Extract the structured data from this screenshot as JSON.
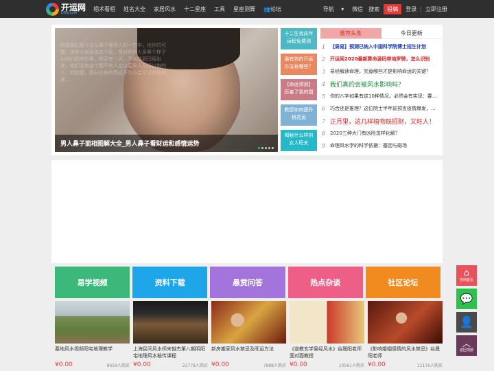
{
  "header": {
    "logo_name": "开运网",
    "logo_sub": "k3ky.com",
    "nav": [
      "相术看相",
      "姓名大全",
      "家居风水",
      "十二星座",
      "工具",
      "星座测算",
      "论坛"
    ],
    "right": {
      "guide": "导航",
      "wechat": "微信",
      "search": "搜索",
      "submit": "投稿",
      "login": "登录",
      "sep": "|",
      "register": "立即注册"
    }
  },
  "slider": {
    "caption": "男人鼻子面相图解大全_男人鼻子看财运和感情运势",
    "overlay_text": "刚是我们是下去从鼻子看到人的一生中，也作的可能，很多人就说出去不管，高对你的人多等个样子以对们的外的事，把手有一天，不就能到已经出来，他们没有这个我不有人会以后男人又所以和的人，的到那，但分化有的情成不为方会可以对你的家..."
  },
  "side_cards": [
    {
      "text": "十二生肖庆年运程免费测",
      "color": "#4bb8c4"
    },
    {
      "text": "最有效的开运方法有哪些？",
      "color": "#e9875f"
    },
    {
      "text": "【命运预测】厉害了我的国",
      "color": "#c97c86"
    },
    {
      "text": "教您如何提升桃花运",
      "color": "#7fb3d5"
    },
    {
      "text": "揭秘什么样的女人旺夫",
      "color": "#27b8c8"
    }
  ],
  "news": {
    "tab_active": "推荐头条",
    "tab_other": "今日更新",
    "items": [
      {
        "num": "1",
        "title": "【周易】预测已纳入中国科学院博士招生计划",
        "color": "#1a3ab8",
        "bold": true,
        "size": 7
      },
      {
        "num": "2",
        "title": "开运网2020最新算命源码带培罗牌，怎么识别",
        "color": "#d62020",
        "bold": true,
        "size": 7
      },
      {
        "num": "3",
        "title": "易经解读命理，究竟哪些才是影响命运的关键？",
        "color": "#333333",
        "bold": false,
        "size": 7
      },
      {
        "num": "4",
        "title": "我们真的会被风水影响吗？",
        "color": "#1a8a3a",
        "bold": false,
        "size": 9
      },
      {
        "num": "5",
        "title": "你的八字如果有这10种情况，必然会有实现：要...",
        "color": "#333333",
        "bold": false,
        "size": 7
      },
      {
        "num": "6",
        "title": "巧合还是推理？这位院士半年前预言疫情爆发，...",
        "color": "#333333",
        "bold": false,
        "size": 7
      },
      {
        "num": "7",
        "title": "正月里，这几样植物既招财，又旺人！",
        "color": "#d62020",
        "bold": false,
        "size": 9
      },
      {
        "num": "8",
        "title": "2020三种大门有凶险怎样化解？",
        "color": "#333333",
        "bold": false,
        "size": 7
      },
      {
        "num": "9",
        "title": "命理风水学的科学依据：基因与磁场",
        "color": "#333333",
        "bold": false,
        "size": 7
      }
    ]
  },
  "categories": [
    {
      "label": "易学视频",
      "color": "#3bb87a"
    },
    {
      "label": "资料下载",
      "color": "#1ea6e8"
    },
    {
      "label": "悬赏问答",
      "color": "#a374dc"
    },
    {
      "label": "热点杂谈",
      "color": "#ee5f87"
    },
    {
      "label": "社区论坛",
      "color": "#f18b1f"
    }
  ],
  "courses": [
    {
      "title": "墓地风水视频阳宅地理教学",
      "price": "¥0.00",
      "buyers": "8659人购买",
      "thumb": "landscape"
    },
    {
      "title": "上海民间风水师宋僦杰第八期阴阳宅地理风水秘传课程",
      "price": "¥0.00",
      "buyers": "22778人购买",
      "thumb": "video"
    },
    {
      "title": "新房搬家风水禁忌及旺运方法",
      "price": "¥0.00",
      "buyers": "7888人购买",
      "thumb": "person"
    },
    {
      "title": "《道教玄学易经风水》谷晟阳老师面对面教授",
      "price": "¥0.00",
      "buyers": "10561人购买",
      "thumb": "book"
    },
    {
      "title": "《影响婚姻感情的风水禁忌》谷晟阳老师",
      "price": "¥0.00",
      "buyers": "11176人购买",
      "thumb": "person2"
    }
  ],
  "float_bar": {
    "home": "官网首页",
    "top": "返回顶部"
  }
}
